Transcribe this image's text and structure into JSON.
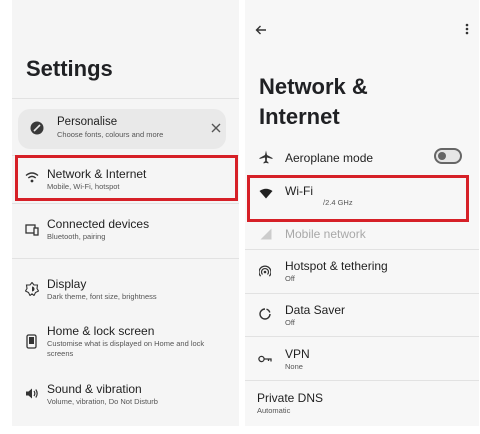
{
  "left": {
    "title": "Settings",
    "suggestion": {
      "title": "Personalise",
      "subtitle": "Choose fonts, colours and more"
    },
    "items": [
      {
        "label": "Network & Internet",
        "sub": "Mobile, Wi-Fi, hotspot",
        "icon": "wifi-icon"
      },
      {
        "label": "Connected devices",
        "sub": "Bluetooth, pairing",
        "icon": "devices-icon"
      },
      {
        "label": "Display",
        "sub": "Dark theme, font size, brightness",
        "icon": "brightness-icon"
      },
      {
        "label": "Home & lock screen",
        "sub": "Customise what is displayed on Home and lock screens",
        "icon": "phone-icon"
      },
      {
        "label": "Sound & vibration",
        "sub": "Volume, vibration, Do Not Disturb",
        "icon": "speaker-icon"
      }
    ]
  },
  "right": {
    "title_line1": "Network &",
    "title_line2": "Internet",
    "items": [
      {
        "label": "Aeroplane mode",
        "sub": "",
        "icon": "airplane-icon"
      },
      {
        "label": "Wi-Fi",
        "sub": "/2.4 GHz",
        "icon": "wifi-icon"
      },
      {
        "label": "Mobile network",
        "sub": "",
        "icon": "signal-icon"
      },
      {
        "label": "Hotspot & tethering",
        "sub": "Off",
        "icon": "hotspot-icon"
      },
      {
        "label": "Data Saver",
        "sub": "Off",
        "icon": "data-saver-icon"
      },
      {
        "label": "VPN",
        "sub": "None",
        "icon": "key-icon"
      },
      {
        "label": "Private DNS",
        "sub": "Automatic",
        "icon": ""
      }
    ],
    "aeroplane_toggle": "off"
  },
  "colors": {
    "highlight": "#d62027",
    "background": "#f5f5f5",
    "text": "#1f1f1f"
  }
}
